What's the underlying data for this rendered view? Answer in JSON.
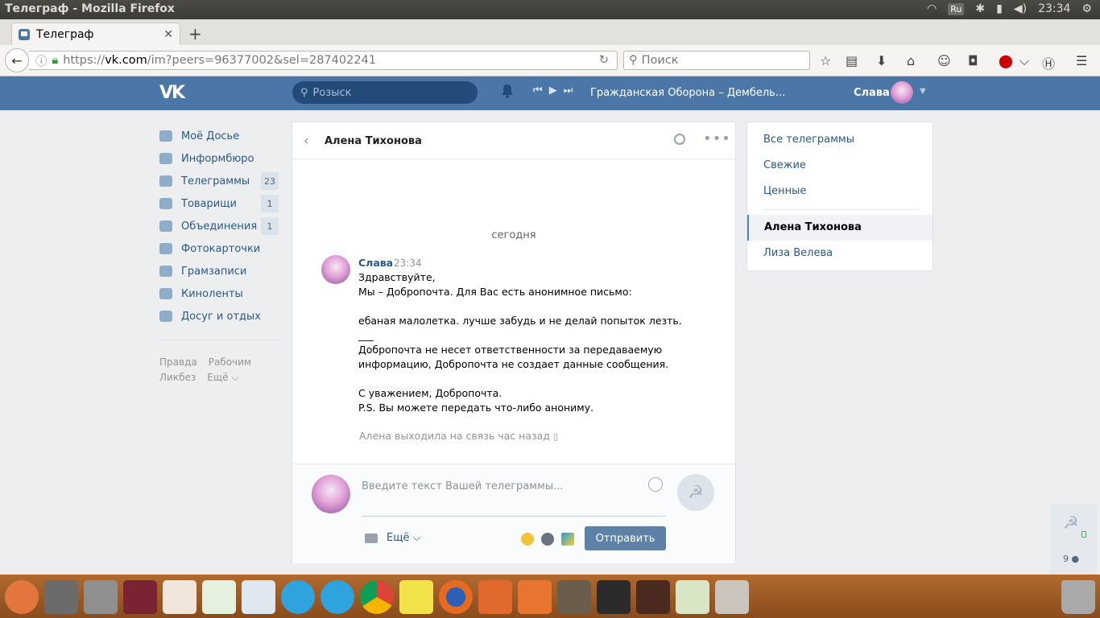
{
  "os": {
    "window_title": "Телеграф - Mozilla Firefox",
    "lang": "Ru",
    "time": "23:34"
  },
  "browser": {
    "tab_title": "Телеграф",
    "url_prefix": "https://",
    "url_host": "vk.com",
    "url_path": "/im?peers=96377002&sel=287402241",
    "search_placeholder": "Поиск"
  },
  "vk": {
    "search_placeholder": "Розыск",
    "now_playing": "Гражданская Оборона – Дембель...",
    "user_name": "Слава",
    "menu": [
      {
        "label": "Моё Досье",
        "count": ""
      },
      {
        "label": "Информбюро",
        "count": ""
      },
      {
        "label": "Телеграммы",
        "count": "23"
      },
      {
        "label": "Товарищи",
        "count": "1"
      },
      {
        "label": "Объединения",
        "count": "1"
      },
      {
        "label": "Фотокарточки",
        "count": ""
      },
      {
        "label": "Грамзаписи",
        "count": ""
      },
      {
        "label": "Киноленты",
        "count": ""
      },
      {
        "label": "Досуг и отдых",
        "count": ""
      }
    ],
    "footer_links": [
      "Правда",
      "Рабочим",
      "Ликбез",
      "Ещё ⌵"
    ],
    "conversation": {
      "peer_name": "Алена Тихонова",
      "day_label": "сегодня",
      "sender": "Слава",
      "time": "23:34",
      "message": "Здравствуйте,\nМы – Добропочта. Для Вас есть анонимное письмо:\n\nебаная малолетка. лучше забудь и не делай попыток лезть.\n___\nДобропочта не несет ответственности за передаваемую\nинформацию, Добропочта не создает данные сообщения.\n\nС уважением, Добропочта.\nP.S. Вы можете передать что-либо анониму.",
      "online_status": "Алена выходила на связь час назад",
      "input_placeholder": "Введите текст Вашей телеграммы...",
      "more_label": "Ещё",
      "send_label": "Отправить"
    },
    "right_panel": {
      "filters": [
        "Все телеграммы",
        "Свежие",
        "Ценные"
      ],
      "dialogs": [
        {
          "name": "Алена Тихонова",
          "selected": true
        },
        {
          "name": "Лиза Велева",
          "selected": false
        }
      ]
    },
    "side_counter": "9"
  },
  "colors": {
    "vk_blue": "#4a76a8",
    "link": "#2a5885",
    "dock": "#9b5a24"
  },
  "dock_apps": [
    "ubuntu-icon",
    "settings-icon",
    "tools-icon",
    "wine-icon",
    "impress-icon",
    "calc-icon",
    "draw-icon",
    "telegram-icon",
    "telegram-icon",
    "chrome-icon",
    "notes-icon",
    "firefox-icon",
    "files-icon",
    "appstore-icon",
    "gimp-icon",
    "terminal-icon",
    "guitar-icon",
    "lingot-icon",
    "archive-icon"
  ]
}
